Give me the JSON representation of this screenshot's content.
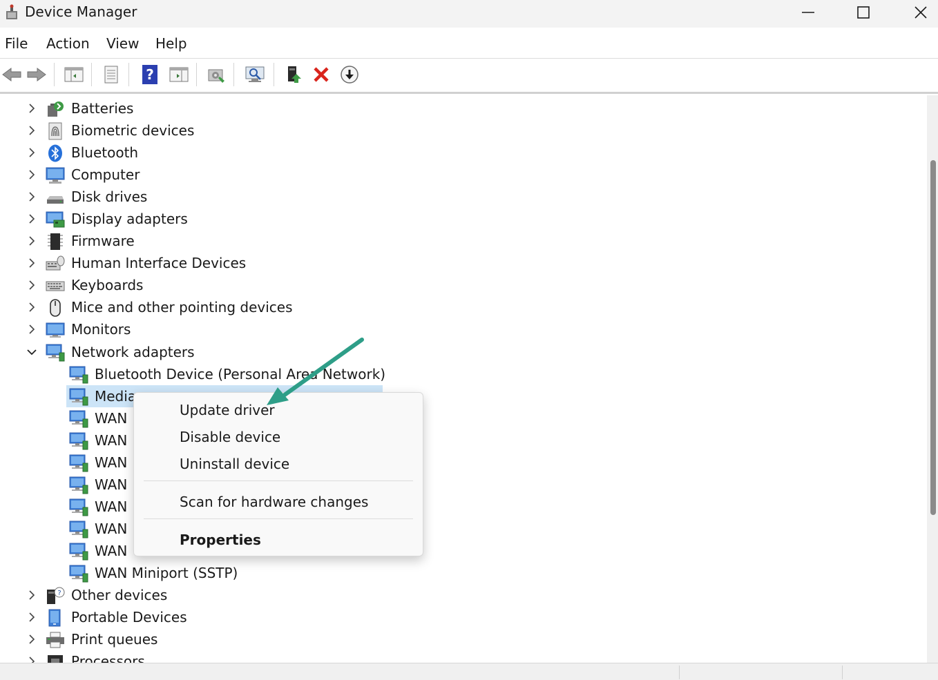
{
  "window": {
    "title": "Device Manager"
  },
  "menubar": {
    "items": [
      "File",
      "Action",
      "View",
      "Help"
    ]
  },
  "toolbar": {
    "buttons": [
      "back-arrow-icon",
      "forward-arrow-icon",
      "show-hide-console-tree-icon",
      "properties-icon",
      "help-icon",
      "action-pane-icon",
      "device-settings-icon",
      "scan-hardware-icon",
      "update-driver-icon",
      "uninstall-device-icon",
      "enable-device-icon"
    ]
  },
  "tree": {
    "categories_top": [
      {
        "label": "Batteries",
        "icon": "battery-icon"
      },
      {
        "label": "Biometric devices",
        "icon": "fingerprint-icon"
      },
      {
        "label": "Bluetooth",
        "icon": "bluetooth-icon"
      },
      {
        "label": "Computer",
        "icon": "computer-icon"
      },
      {
        "label": "Disk drives",
        "icon": "disk-drive-icon"
      },
      {
        "label": "Display adapters",
        "icon": "display-adapter-icon"
      },
      {
        "label": "Firmware",
        "icon": "firmware-chip-icon"
      },
      {
        "label": "Human Interface Devices",
        "icon": "hid-icon"
      },
      {
        "label": "Keyboards",
        "icon": "keyboard-icon"
      },
      {
        "label": "Mice and other pointing devices",
        "icon": "mouse-icon"
      },
      {
        "label": "Monitors",
        "icon": "monitor-icon"
      }
    ],
    "expanded_category": {
      "label": "Network adapters",
      "icon": "network-adapter-icon"
    },
    "network_children": [
      "Bluetooth Device (Personal Area Network)",
      "Media",
      "WAN",
      "WAN",
      "WAN",
      "WAN",
      "WAN",
      "WAN",
      "WAN",
      "WAN Miniport (SSTP)"
    ],
    "categories_bottom": [
      {
        "label": "Other devices",
        "icon": "unknown-device-icon"
      },
      {
        "label": "Portable Devices",
        "icon": "portable-device-icon"
      },
      {
        "label": "Print queues",
        "icon": "printer-icon"
      },
      {
        "label": "Processors",
        "icon": "processor-icon"
      }
    ]
  },
  "context_menu": {
    "items": [
      "Update driver",
      "Disable device",
      "Uninstall device"
    ],
    "scan": "Scan for hardware changes",
    "properties": "Properties"
  },
  "colors": {
    "selection": "#cce4f7",
    "annotation_arrow": "#2e9e88",
    "uninstall_red": "#d9241c",
    "help_blue": "#2b3fb0"
  }
}
